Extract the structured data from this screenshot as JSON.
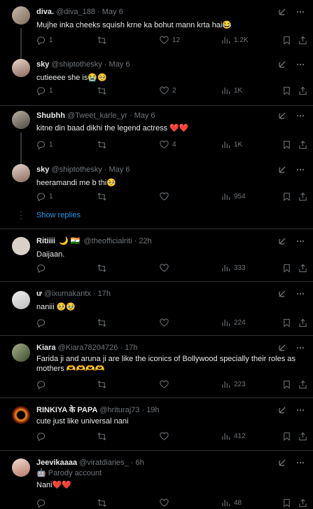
{
  "posts": [
    {
      "name": "diva.",
      "handle": "@diva_188",
      "time": "May 6",
      "text": "Mujhe inka cheeks squish krne ka bohut mann krta hai😂",
      "replies": "1",
      "retweets": "",
      "likes": "12",
      "views": "1.2K"
    },
    {
      "name": "sky",
      "handle": "@shiptothesky",
      "time": "May 6",
      "text": "cutieeee she is😭🥺",
      "replies": "1",
      "retweets": "",
      "likes": "2",
      "views": "1K"
    },
    {
      "name": "Shubhh",
      "handle": "@Tweet_karle_yr",
      "time": "May 6",
      "text": "kitne din baad dikhi the legend actress ❤️❤️",
      "replies": "1",
      "retweets": "",
      "likes": "4",
      "views": "1K"
    },
    {
      "name": "sky",
      "handle": "@shiptothesky",
      "time": "May 6",
      "text": "heeramandi me b thi🥺",
      "replies": "1",
      "retweets": "",
      "likes": "",
      "views": "954"
    },
    {
      "name": "Ritiiii",
      "name_extra": "🌙 🇮🇳",
      "handle": "@theofficialriti",
      "time": "22h",
      "text": "Daijaan.",
      "replies": "",
      "retweets": "",
      "likes": "",
      "views": "333"
    },
    {
      "name": "ư",
      "handle": "@ixumakantx",
      "time": "17h",
      "text": "naniii 🥺🥹",
      "replies": "",
      "retweets": "",
      "likes": "",
      "views": "224"
    },
    {
      "name": "Kiara",
      "handle": "@Kiara78204726",
      "time": "17h",
      "text": "Farida ji and aruna ji are like the iconics of Bollywood specially their roles as mothers 🫶🫶🫶🫶",
      "replies": "",
      "retweets": "",
      "likes": "",
      "views": "223"
    },
    {
      "name": "RINKIYA के PAPA",
      "handle": "@hrituraj73",
      "time": "19h",
      "text": "cute just like universal nani",
      "replies": "",
      "retweets": "",
      "likes": "",
      "views": "412"
    },
    {
      "name": "Jeevikaaaa",
      "handle": "@viratdiaries_",
      "time": "6h",
      "badge": "🤖 Parody account",
      "text": "Nani❤️❤️",
      "replies": "",
      "retweets": "",
      "likes": "",
      "views": "48"
    }
  ],
  "show_replies": "Show replies",
  "separator": "·",
  "icons": [
    "reply-icon",
    "retweet-icon",
    "like-icon",
    "views-icon",
    "bookmark-icon",
    "share-icon",
    "grok-icon",
    "more-icon"
  ],
  "colors": {
    "background": "#000000",
    "text": "#e7e9ea",
    "muted": "#71767b",
    "link": "#1d9bf0",
    "divider": "#2f3336"
  }
}
